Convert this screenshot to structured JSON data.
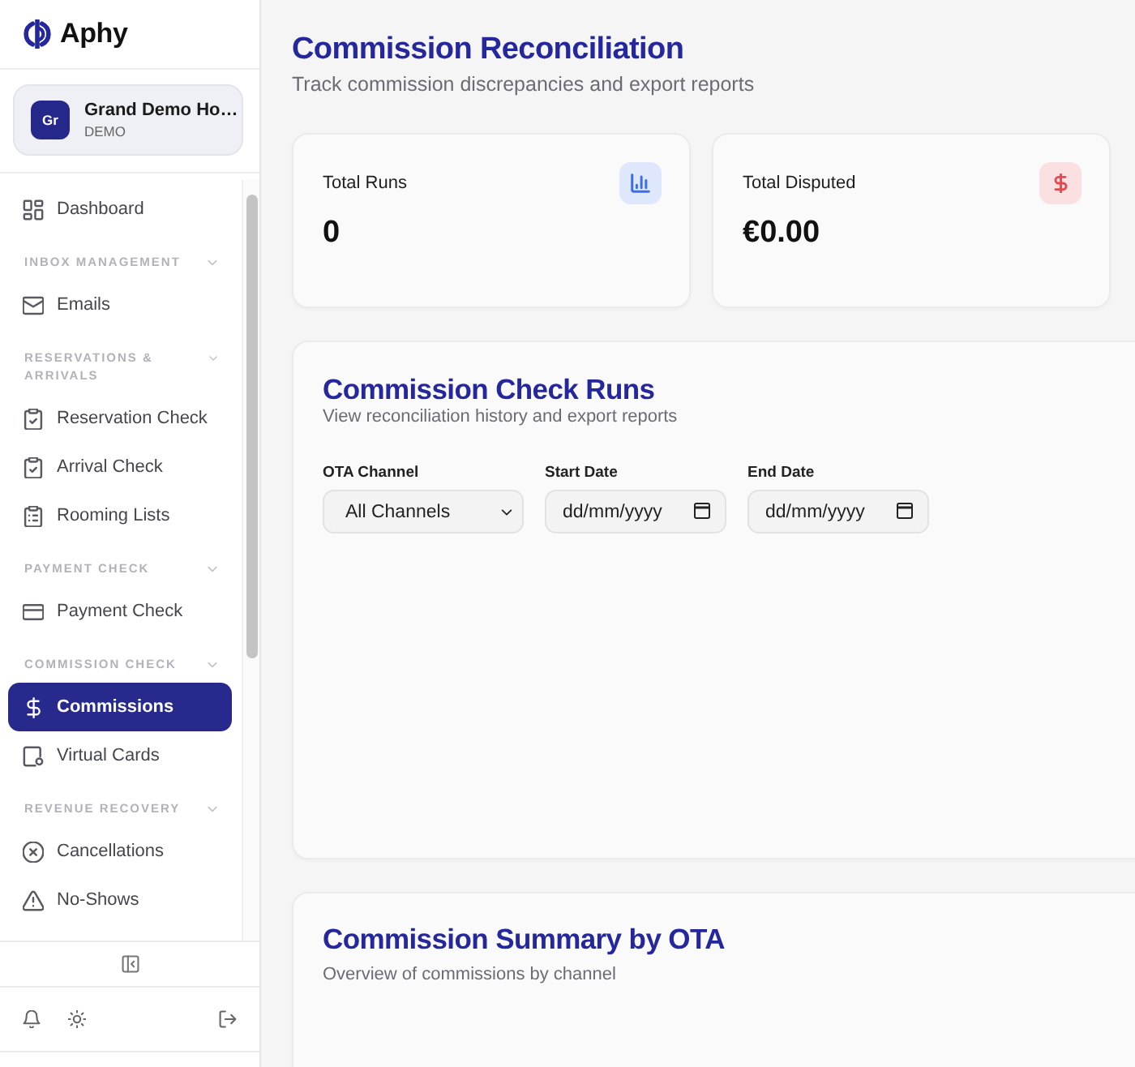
{
  "brand": {
    "name": "Aphy"
  },
  "account": {
    "initials": "Gr",
    "name": "Grand Demo Ho…",
    "plan": "DEMO"
  },
  "nav": [
    {
      "kind": "item",
      "label": "Dashboard",
      "selected": false
    },
    {
      "kind": "section",
      "label": "INBOX MANAGEMENT",
      "expanded": true,
      "items": [
        {
          "label": "Emails",
          "selected": false
        }
      ]
    },
    {
      "kind": "section",
      "label": "RESERVATIONS & ARRIVALS",
      "expanded": true,
      "items": [
        {
          "label": "Reservation Check",
          "selected": false
        },
        {
          "label": "Arrival Check",
          "selected": false
        },
        {
          "label": "Rooming Lists",
          "selected": false
        }
      ]
    },
    {
      "kind": "section",
      "label": "PAYMENT CHECK",
      "expanded": true,
      "items": [
        {
          "label": "Payment Check",
          "selected": false
        }
      ]
    },
    {
      "kind": "section",
      "label": "COMMISSION CHECK",
      "expanded": true,
      "items": [
        {
          "label": "Commissions",
          "selected": true
        },
        {
          "label": "Virtual Cards",
          "selected": false
        }
      ]
    },
    {
      "kind": "section",
      "label": "REVENUE RECOVERY",
      "expanded": true,
      "items": [
        {
          "label": "Cancellations",
          "selected": false
        },
        {
          "label": "No-Shows",
          "selected": false
        }
      ]
    }
  ],
  "page": {
    "title": "Commission Reconciliation",
    "subtitle": "Track commission discrepancies and export reports"
  },
  "stats": [
    {
      "label": "Total Runs",
      "value": "0",
      "color": "#3b6fe6"
    },
    {
      "label": "Total Disputed",
      "value": "€0.00",
      "color": "#e5484d"
    }
  ],
  "runs": {
    "title": "Commission Check Runs",
    "subtitle": "View reconciliation history and export reports",
    "filters": [
      {
        "kind": "select",
        "label": "OTA Channel",
        "value": "All Channels"
      },
      {
        "kind": "date",
        "label": "Start Date",
        "placeholder": "dd/mm/yyyy"
      },
      {
        "kind": "date",
        "label": "End Date",
        "placeholder": "dd/mm/yyyy"
      }
    ]
  },
  "summary": {
    "title": "Commission Summary by OTA",
    "subtitle": "Overview of commissions by channel"
  }
}
